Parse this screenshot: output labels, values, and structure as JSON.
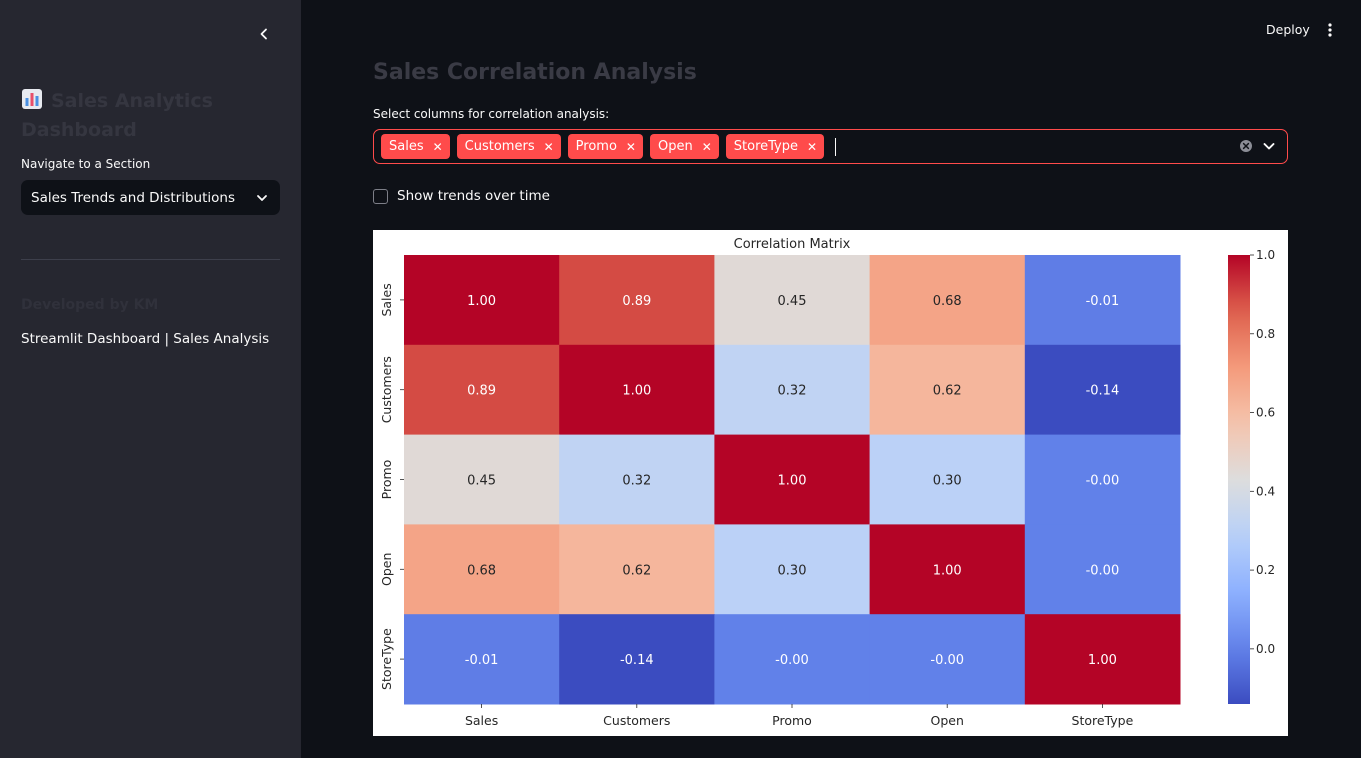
{
  "sidebar": {
    "title": "Sales Analytics Dashboard",
    "title_icon": "bar-chart-emoji-icon",
    "nav_label": "Navigate to a Section",
    "nav_selected": "Sales Trends and Distributions",
    "developed_by": "Developed by KM",
    "footer": "Streamlit Dashboard | Sales Analysis"
  },
  "header": {
    "deploy_label": "Deploy"
  },
  "main": {
    "title": "Sales Correlation Analysis",
    "multiselect_label": "Select columns for correlation analysis:",
    "selected_columns": [
      "Sales",
      "Customers",
      "Promo",
      "Open",
      "StoreType"
    ],
    "checkbox_label": "Show trends over time",
    "checkbox_checked": false
  },
  "colors": {
    "accent": "#ff4b4b",
    "sidebar_bg": "#262730",
    "main_bg": "#0e1117"
  },
  "chart_data": {
    "type": "heatmap",
    "title": "Correlation Matrix",
    "colormap": "coolwarm",
    "x": [
      "Sales",
      "Customers",
      "Promo",
      "Open",
      "StoreType"
    ],
    "y": [
      "Sales",
      "Customers",
      "Promo",
      "Open",
      "StoreType"
    ],
    "values": [
      [
        1.0,
        0.89,
        0.45,
        0.68,
        -0.01
      ],
      [
        0.89,
        1.0,
        0.32,
        0.62,
        -0.14
      ],
      [
        0.45,
        0.32,
        1.0,
        0.3,
        -0.0
      ],
      [
        0.68,
        0.62,
        0.3,
        1.0,
        -0.0
      ],
      [
        -0.01,
        -0.14,
        -0.0,
        -0.0,
        1.0
      ]
    ],
    "annotations": [
      [
        "1.00",
        "0.89",
        "0.45",
        "0.68",
        "-0.01"
      ],
      [
        "0.89",
        "1.00",
        "0.32",
        "0.62",
        "-0.14"
      ],
      [
        "0.45",
        "0.32",
        "1.00",
        "0.30",
        "-0.00"
      ],
      [
        "0.68",
        "0.62",
        "0.30",
        "1.00",
        "-0.00"
      ],
      [
        "-0.01",
        "-0.14",
        "-0.00",
        "-0.00",
        "1.00"
      ]
    ],
    "colorbar": {
      "range": [
        -0.14,
        1.0
      ],
      "ticks": [
        0.0,
        0.2,
        0.4,
        0.6,
        0.8,
        1.0
      ],
      "tick_labels": [
        "0.0",
        "0.2",
        "0.4",
        "0.6",
        "0.8",
        "1.0"
      ]
    }
  }
}
